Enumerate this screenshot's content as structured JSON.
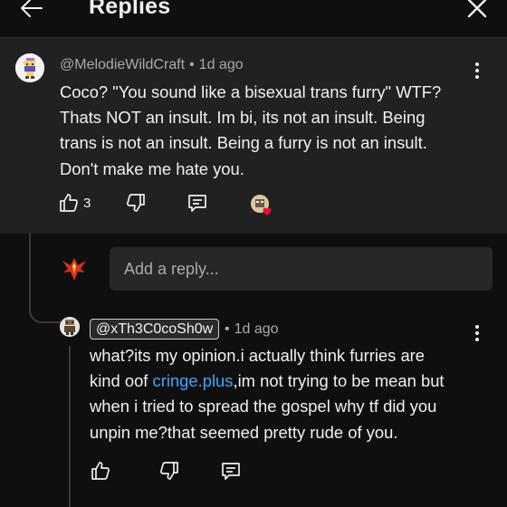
{
  "header": {
    "title": "Replies",
    "back_icon": "arrow-left-icon",
    "close_icon": "close-icon"
  },
  "parent_comment": {
    "author": "@MelodieWildCraft",
    "time": "1d ago",
    "text_lines": [
      "Coco? \"You sound like a bisexual trans furry\" WTF?",
      "Thats NOT an insult. Im bi, its not an insult. Being",
      "trans is not an insult. Being a furry is not an insult.",
      "Don't make me hate you."
    ],
    "like_count": "3"
  },
  "reply_box": {
    "placeholder": "Add a reply..."
  },
  "reply_comment": {
    "mention": "@xTh3C0coSh0w",
    "time": "1d ago",
    "text_line1": "what?its my opinion.i actually think furries are",
    "text_line2_a": "kind oof ",
    "text_line2_link": "cringe.plus",
    "text_line2_b": ",im not trying to be mean but",
    "text_line3": "when i tried to spread the gospel why tf did you",
    "text_line4": "unpin me?that seemed pretty rude of you."
  },
  "colors": {
    "background": "#0f0f0f",
    "comment_highlight": "#212121",
    "link": "#3ea6ff",
    "heart": "#ff0033"
  }
}
